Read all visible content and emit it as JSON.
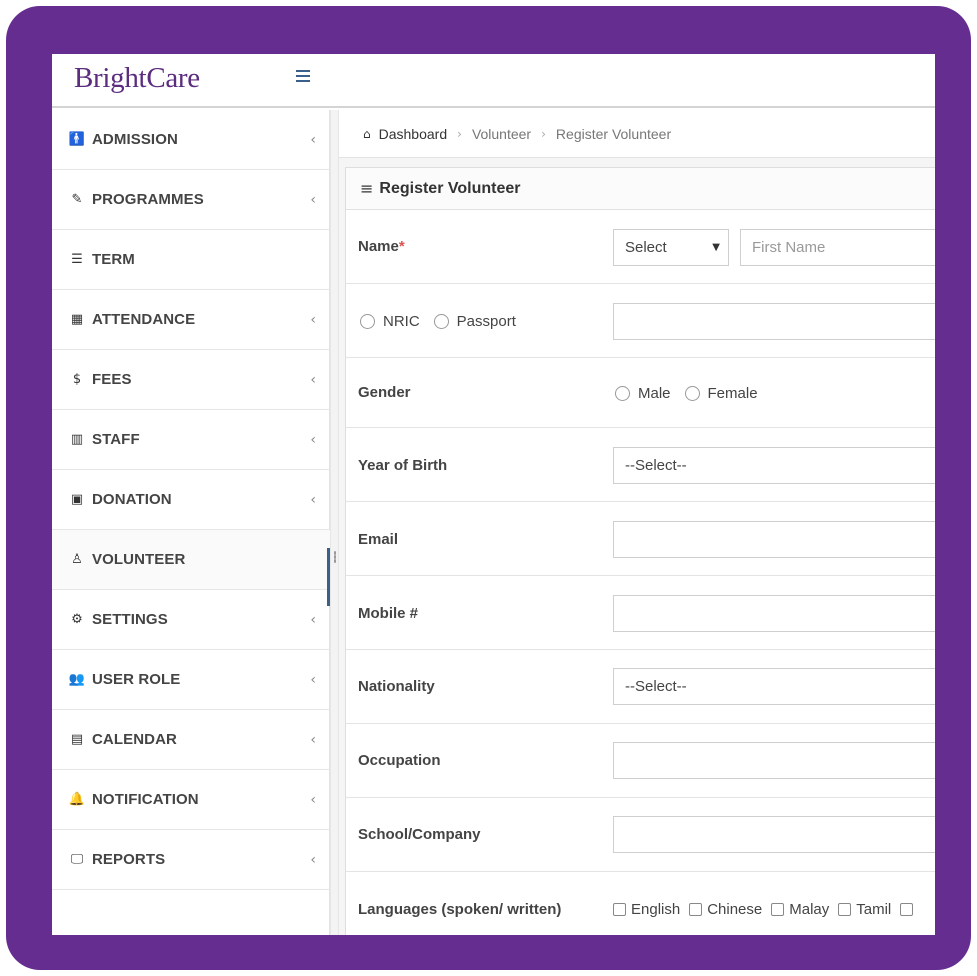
{
  "app": {
    "logo": "BrightCare"
  },
  "sidebar": {
    "items": [
      {
        "label": "ADMISSION",
        "icon": "🚹",
        "chevron": "‹"
      },
      {
        "label": "PROGRAMMES",
        "icon": "✎",
        "chevron": "‹"
      },
      {
        "label": "TERM",
        "icon": "☰",
        "chevron": ""
      },
      {
        "label": "ATTENDANCE",
        "icon": "▦",
        "chevron": "‹"
      },
      {
        "label": "FEES",
        "icon": "$",
        "chevron": "‹"
      },
      {
        "label": "STAFF",
        "icon": "▥",
        "chevron": "‹"
      },
      {
        "label": "DONATION",
        "icon": "▣",
        "chevron": "‹"
      },
      {
        "label": "VOLUNTEER",
        "icon": "♙",
        "chevron": ""
      },
      {
        "label": "SETTINGS",
        "icon": "⚙",
        "chevron": "‹"
      },
      {
        "label": "USER ROLE",
        "icon": "👥",
        "chevron": "‹"
      },
      {
        "label": "CALENDAR",
        "icon": "▤",
        "chevron": "‹"
      },
      {
        "label": "NOTIFICATION",
        "icon": "🔔",
        "chevron": "‹"
      },
      {
        "label": "REPORTS",
        "icon": "🖵",
        "chevron": "‹"
      }
    ],
    "active": "VOLUNTEER"
  },
  "breadcrumb": {
    "home_icon": "⌂",
    "sep": "›",
    "items": [
      "Dashboard",
      "Volunteer",
      "Register Volunteer"
    ]
  },
  "panel": {
    "menu_icon": "≡",
    "title": "Register Volunteer"
  },
  "form": {
    "name": {
      "label": "Name",
      "required_mark": "*",
      "salutation_value": "Select",
      "caret": "▼",
      "first_name_placeholder": "First Name"
    },
    "id_type": {
      "options": [
        "NRIC",
        "Passport"
      ],
      "value": ""
    },
    "gender": {
      "label": "Gender",
      "options": [
        "Male",
        "Female"
      ]
    },
    "year_of_birth": {
      "label": "Year of Birth",
      "value": "--Select--"
    },
    "email": {
      "label": "Email",
      "value": ""
    },
    "mobile": {
      "label": "Mobile #",
      "value": ""
    },
    "nationality": {
      "label": "Nationality",
      "value": "--Select--"
    },
    "occupation": {
      "label": "Occupation",
      "value": ""
    },
    "school_company": {
      "label": "School/Company",
      "value": ""
    },
    "languages": {
      "label": "Languages (spoken/ written)",
      "options": [
        "English",
        "Chinese",
        "Malay",
        "Tamil"
      ]
    }
  },
  "colors": {
    "frame": "#662d91",
    "logo": "#5c2d7f",
    "active_marker": "#3c5f86",
    "required": "#d9534f"
  }
}
